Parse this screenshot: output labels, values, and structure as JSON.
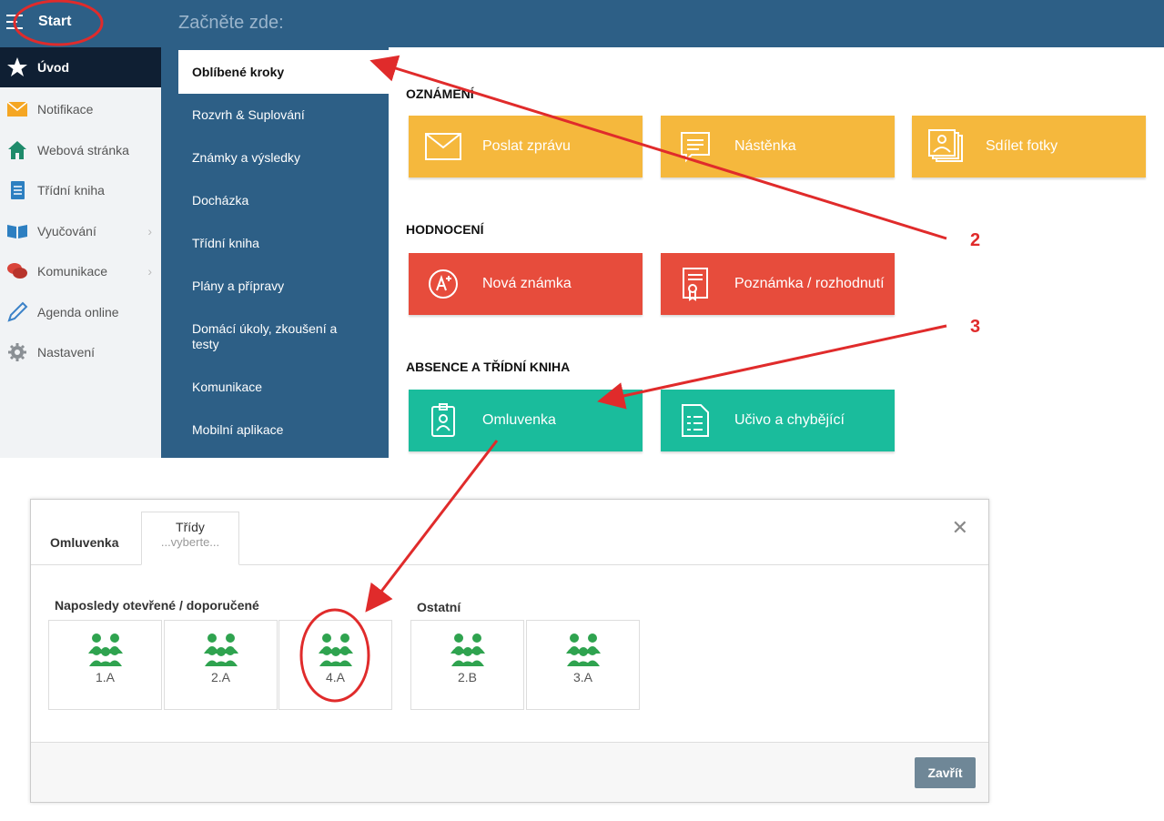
{
  "topbar": {
    "start_label": "Start",
    "title": "Začněte zde:"
  },
  "sidebar": {
    "items": [
      {
        "label": "Úvod",
        "icon": "star-icon"
      },
      {
        "label": "Notifikace",
        "icon": "envelope-icon"
      },
      {
        "label": "Webová stránka",
        "icon": "house-icon"
      },
      {
        "label": "Třídní kniha",
        "icon": "notebook-icon"
      },
      {
        "label": "Vyučování",
        "icon": "open-book-icon"
      },
      {
        "label": "Komunikace",
        "icon": "chat-icon"
      },
      {
        "label": "Agenda online",
        "icon": "pen-icon"
      },
      {
        "label": "Nastavení",
        "icon": "gear-icon"
      }
    ]
  },
  "submenu": {
    "items": [
      "Oblíbené kroky",
      "Rozvrh & Suplování",
      "Známky a výsledky",
      "Docházka",
      "Třídní kniha",
      "Plány a přípravy",
      "Domácí úkoly, zkoušení a testy",
      "Komunikace",
      "Mobilní aplikace"
    ]
  },
  "main": {
    "sections": [
      {
        "title": "OZNÁMENÍ",
        "tiles": [
          "Poslat zprávu",
          "Nástěnka",
          "Sdílet fotky"
        ]
      },
      {
        "title": "HODNOCENÍ",
        "tiles": [
          "Nová známka",
          "Poznámka / rozhodnutí"
        ]
      },
      {
        "title": "ABSENCE A TŘÍDNÍ KNIHA",
        "tiles": [
          "Omluvenka",
          "Učivo a chybějící"
        ]
      }
    ],
    "colors": {
      "yellow": "#f5b83d",
      "red": "#e74c3c",
      "green": "#1abc9c",
      "nav": "#2d5f86"
    }
  },
  "dialog": {
    "tab1": "Omluvenka",
    "tab2_title": "Třídy",
    "tab2_sub": "...vyberte...",
    "recent_label": "Naposledy otevřené / doporučené",
    "other_label": "Ostatní",
    "recent_classes": [
      "1.A",
      "2.A",
      "4.A"
    ],
    "other_classes": [
      "2.B",
      "3.A"
    ],
    "close_label": "Zavřít"
  },
  "annotations": {
    "step2": "2",
    "step3": "3",
    "color": "#e02b2b"
  }
}
